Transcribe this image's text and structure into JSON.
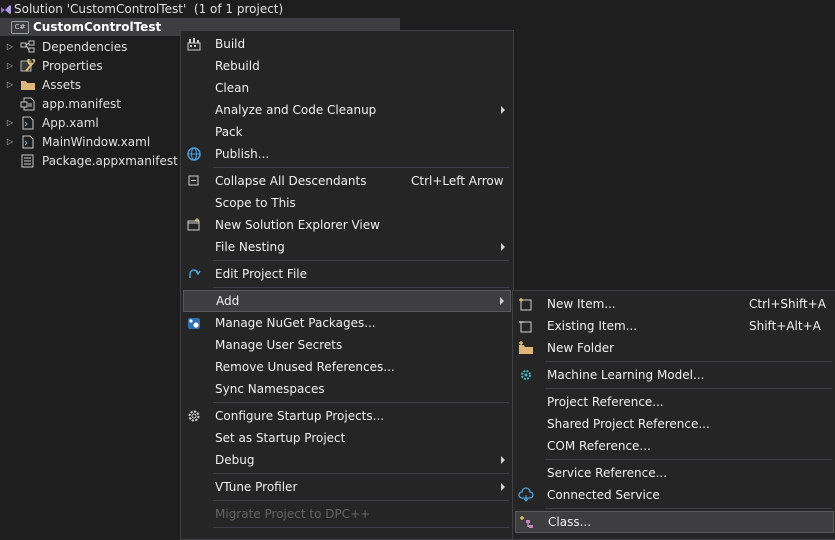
{
  "solution_explorer": {
    "solution_label": "Solution 'CustomControlTest'  (1 of 1 project)",
    "project": {
      "badge": "C#",
      "name": "CustomControlTest"
    },
    "items": [
      {
        "label": "Dependencies",
        "icon": "dependencies-icon",
        "expandable": true
      },
      {
        "label": "Properties",
        "icon": "properties-wrench-icon",
        "expandable": true
      },
      {
        "label": "Assets",
        "icon": "folder-icon",
        "expandable": true
      },
      {
        "label": "app.manifest",
        "icon": "manifest-file-icon",
        "expandable": false
      },
      {
        "label": "App.xaml",
        "icon": "xaml-file-icon",
        "expandable": true
      },
      {
        "label": "MainWindow.xaml",
        "icon": "xaml-file-icon",
        "expandable": true
      },
      {
        "label": "Package.appxmanifest",
        "icon": "appx-manifest-icon",
        "expandable": false
      }
    ]
  },
  "context_menu": {
    "items": [
      {
        "label": "Build",
        "icon": "build-icon"
      },
      {
        "label": "Rebuild"
      },
      {
        "label": "Clean"
      },
      {
        "label": "Analyze and Code Cleanup",
        "submenu": true
      },
      {
        "label": "Pack"
      },
      {
        "label": "Publish...",
        "icon": "globe-icon"
      },
      {
        "label": "Collapse All Descendants",
        "icon": "collapse-icon",
        "shortcut": "Ctrl+Left Arrow"
      },
      {
        "label": "Scope to This"
      },
      {
        "label": "New Solution Explorer View",
        "icon": "new-view-icon"
      },
      {
        "label": "File Nesting",
        "submenu": true
      },
      {
        "label": "Edit Project File",
        "icon": "edit-redo-icon"
      },
      {
        "label": "Add",
        "submenu": true,
        "highlighted": true
      },
      {
        "label": "Manage NuGet Packages...",
        "icon": "nuget-icon"
      },
      {
        "label": "Manage User Secrets"
      },
      {
        "label": "Remove Unused References..."
      },
      {
        "label": "Sync Namespaces"
      },
      {
        "label": "Configure Startup Projects...",
        "icon": "gear-icon"
      },
      {
        "label": "Set as Startup Project"
      },
      {
        "label": "Debug",
        "submenu": true
      },
      {
        "label": "VTune Profiler",
        "submenu": true
      },
      {
        "label": "Migrate Project to DPC++",
        "disabled": true
      }
    ]
  },
  "add_submenu": {
    "items": [
      {
        "label": "New Item...",
        "icon": "new-item-icon",
        "shortcut": "Ctrl+Shift+A"
      },
      {
        "label": "Existing Item...",
        "icon": "existing-item-icon",
        "shortcut": "Shift+Alt+A"
      },
      {
        "label": "New Folder",
        "icon": "new-folder-icon"
      },
      {
        "label": "Machine Learning Model...",
        "icon": "ml-model-icon"
      },
      {
        "label": "Project Reference..."
      },
      {
        "label": "Shared Project Reference..."
      },
      {
        "label": "COM Reference..."
      },
      {
        "label": "Service Reference..."
      },
      {
        "label": "Connected Service",
        "icon": "connected-service-icon"
      },
      {
        "label": "Class...",
        "icon": "class-icon",
        "highlighted": true
      }
    ]
  },
  "colors": {
    "background": "#1e1e1e",
    "menu_background": "#252526",
    "menu_border": "#3f3f46",
    "highlight": "#3e3e40",
    "text": "#f1f1f1",
    "disabled_text": "#656565"
  }
}
